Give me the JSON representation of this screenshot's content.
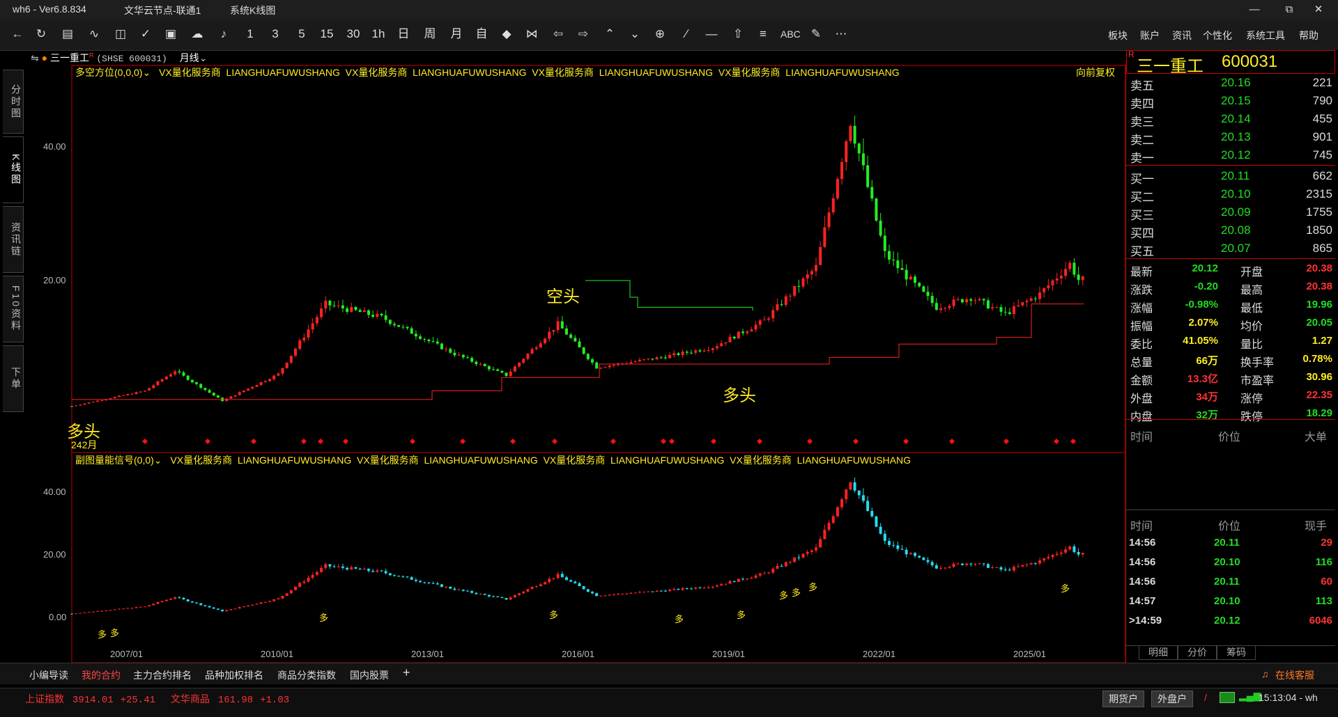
{
  "titlebar": {
    "app": "wh6 - Ver6.8.834",
    "node": "文华云节点-联通1",
    "window": "系统K线图"
  },
  "toolbar": {
    "periods": [
      "1",
      "3",
      "5",
      "15",
      "30",
      "1h",
      "日",
      "周",
      "月",
      "自"
    ],
    "text_tools": [
      "ABC"
    ],
    "menus": [
      "板块",
      "账户",
      "资讯",
      "个性化",
      "系统工具",
      "帮助"
    ]
  },
  "left_tabs": [
    "分时图",
    "K线图",
    "资讯链",
    "F10资料",
    "下单"
  ],
  "chart": {
    "symbol_line": "三一重工",
    "symbol_code": "(SHSE 600031)",
    "r_mark": "R",
    "period": "月线",
    "main_indicator": "多空方位(0,0,0)",
    "main_ads": "VX量化服务商  LIANGHUAFUWUSHANG  VX量化服务商  LIANGHUAFUWUSHANG  VX量化服务商  LIANGHUAFUWUSHANG  VX量化服务商  LIANGHUAFUWUSHANG",
    "adjust": "向前复权",
    "sub_indicator": "副图量能信号(0,0)",
    "sub_ads": "VX量化服务商  LIANGHUAFUWUSHANG  VX量化服务商  LIANGHUAFUWUSHANG  VX量化服务商  LIANGHUAFUWUSHANG  VX量化服务商  LIANGHUAFUWUSHANG",
    "label_kong": "空头",
    "label_duo": "多头",
    "label_left": "多头",
    "start_month": "242月",
    "sub_signal": "多",
    "main_y_ticks": [
      "40.00",
      "20.00"
    ],
    "sub_y_ticks": [
      "40.00",
      "20.00",
      "0.00"
    ],
    "x_ticks": [
      "2007/01",
      "2010/01",
      "2013/01",
      "2016/01",
      "2019/01",
      "2022/01",
      "2025/01"
    ],
    "colors": {
      "up": "#ff2222",
      "down": "#22ee22",
      "sub_down": "#22ddee",
      "signal": "#ff1111",
      "text": "#ffee22"
    }
  },
  "chart_data": {
    "type": "candlestick",
    "title": "三一重工 (SHSE 600031) 月线",
    "x_ticks": [
      "2007/01",
      "2010/01",
      "2013/01",
      "2016/01",
      "2019/01",
      "2022/01",
      "2025/01"
    ],
    "y_ticks": [
      20,
      40
    ],
    "approx_close_series": [
      {
        "date": "2006/01",
        "value": 1.2
      },
      {
        "date": "2007/06",
        "value": 3.5
      },
      {
        "date": "2008/01",
        "value": 6.5
      },
      {
        "date": "2008/12",
        "value": 2.0
      },
      {
        "date": "2010/01",
        "value": 6.0
      },
      {
        "date": "2010/12",
        "value": 16.5
      },
      {
        "date": "2012/01",
        "value": 14.5
      },
      {
        "date": "2013/06",
        "value": 9.0
      },
      {
        "date": "2014/06",
        "value": 5.8
      },
      {
        "date": "2015/06",
        "value": 13.5
      },
      {
        "date": "2016/03",
        "value": 7.0
      },
      {
        "date": "2017/06",
        "value": 8.5
      },
      {
        "date": "2018/06",
        "value": 10.0
      },
      {
        "date": "2019/06",
        "value": 14.0
      },
      {
        "date": "2020/06",
        "value": 22.0
      },
      {
        "date": "2021/02",
        "value": 44.0
      },
      {
        "date": "2021/10",
        "value": 24.0
      },
      {
        "date": "2022/10",
        "value": 16.0
      },
      {
        "date": "2023/06",
        "value": 17.5
      },
      {
        "date": "2024/02",
        "value": 15.0
      },
      {
        "date": "2024/10",
        "value": 18.0
      },
      {
        "date": "2025/05",
        "value": 22.5
      },
      {
        "date": "2025/07",
        "value": 20.12
      }
    ]
  },
  "quote": {
    "name": "三一重工",
    "code": "600031",
    "r_mark": "R",
    "asks": [
      {
        "label": "卖五",
        "price": "20.16",
        "vol": "221"
      },
      {
        "label": "卖四",
        "price": "20.15",
        "vol": "790"
      },
      {
        "label": "卖三",
        "price": "20.14",
        "vol": "455"
      },
      {
        "label": "卖二",
        "price": "20.13",
        "vol": "901"
      },
      {
        "label": "卖一",
        "price": "20.12",
        "vol": "745"
      }
    ],
    "bids": [
      {
        "label": "买一",
        "price": "20.11",
        "vol": "662"
      },
      {
        "label": "买二",
        "price": "20.10",
        "vol": "2315"
      },
      {
        "label": "买三",
        "price": "20.09",
        "vol": "1755"
      },
      {
        "label": "买四",
        "price": "20.08",
        "vol": "1850"
      },
      {
        "label": "买五",
        "price": "20.07",
        "vol": "865"
      }
    ],
    "stats": [
      {
        "l1": "最新",
        "v1": "20.12",
        "c1": "g",
        "l2": "开盘",
        "v2": "20.38",
        "c2": "r"
      },
      {
        "l1": "涨跌",
        "v1": "-0.20",
        "c1": "g",
        "l2": "最高",
        "v2": "20.38",
        "c2": "r"
      },
      {
        "l1": "涨幅",
        "v1": "-0.98%",
        "c1": "g",
        "l2": "最低",
        "v2": "19.96",
        "c2": "g"
      },
      {
        "l1": "振幅",
        "v1": "2.07%",
        "c1": "y",
        "l2": "均价",
        "v2": "20.05",
        "c2": "g"
      },
      {
        "l1": "委比",
        "v1": "41.05%",
        "c1": "y",
        "l2": "量比",
        "v2": "1.27",
        "c2": "y"
      },
      {
        "l1": "总量",
        "v1": "66万",
        "c1": "y",
        "l2": "换手率",
        "v2": "0.78%",
        "c2": "y"
      },
      {
        "l1": "金额",
        "v1": "13.3亿",
        "c1": "r",
        "l2": "市盈率",
        "v2": "30.96",
        "c2": "y"
      },
      {
        "l1": "外盘",
        "v1": "34万",
        "c1": "r",
        "l2": "涨停",
        "v2": "22.35",
        "c2": "r"
      },
      {
        "l1": "内盘",
        "v1": "32万",
        "c1": "g",
        "l2": "跌停",
        "v2": "18.29",
        "c2": "g"
      }
    ],
    "big_order_headers": [
      "时间",
      "价位",
      "大单"
    ],
    "tick_headers": [
      "时间",
      "价位",
      "现手"
    ],
    "ticks": [
      {
        "time": "14:56",
        "price": "20.11",
        "vol": "29",
        "c": "r"
      },
      {
        "time": "14:56",
        "price": "20.10",
        "vol": "116",
        "c": "g"
      },
      {
        "time": "14:56",
        "price": "20.11",
        "vol": "60",
        "c": "r"
      },
      {
        "time": "14:57",
        "price": "20.10",
        "vol": "113",
        "c": "g"
      },
      {
        "time": "14:59",
        "price": "20.12",
        "vol": "6046",
        "c": "r"
      }
    ],
    "tick_marker": ">",
    "panel_tabs": [
      "明细",
      "分价",
      "筹码"
    ]
  },
  "bottom": {
    "tabs": [
      "小编导读",
      "我的合约",
      "主力合约排名",
      "品种加权排名",
      "商品分类指数",
      "国内股票"
    ],
    "active_tab": 1,
    "add": "+",
    "service": "在线客服"
  },
  "status": {
    "idx1_name": "上证指数",
    "idx1_val": "3914.01",
    "idx1_chg": "+25.41",
    "idx2_name": "文华商品",
    "idx2_val": "161.98",
    "idx2_chg": "+1.03",
    "btn1": "期货户",
    "btn2": "外盘户",
    "sep": "/",
    "time": "15:13:04 - wh"
  }
}
